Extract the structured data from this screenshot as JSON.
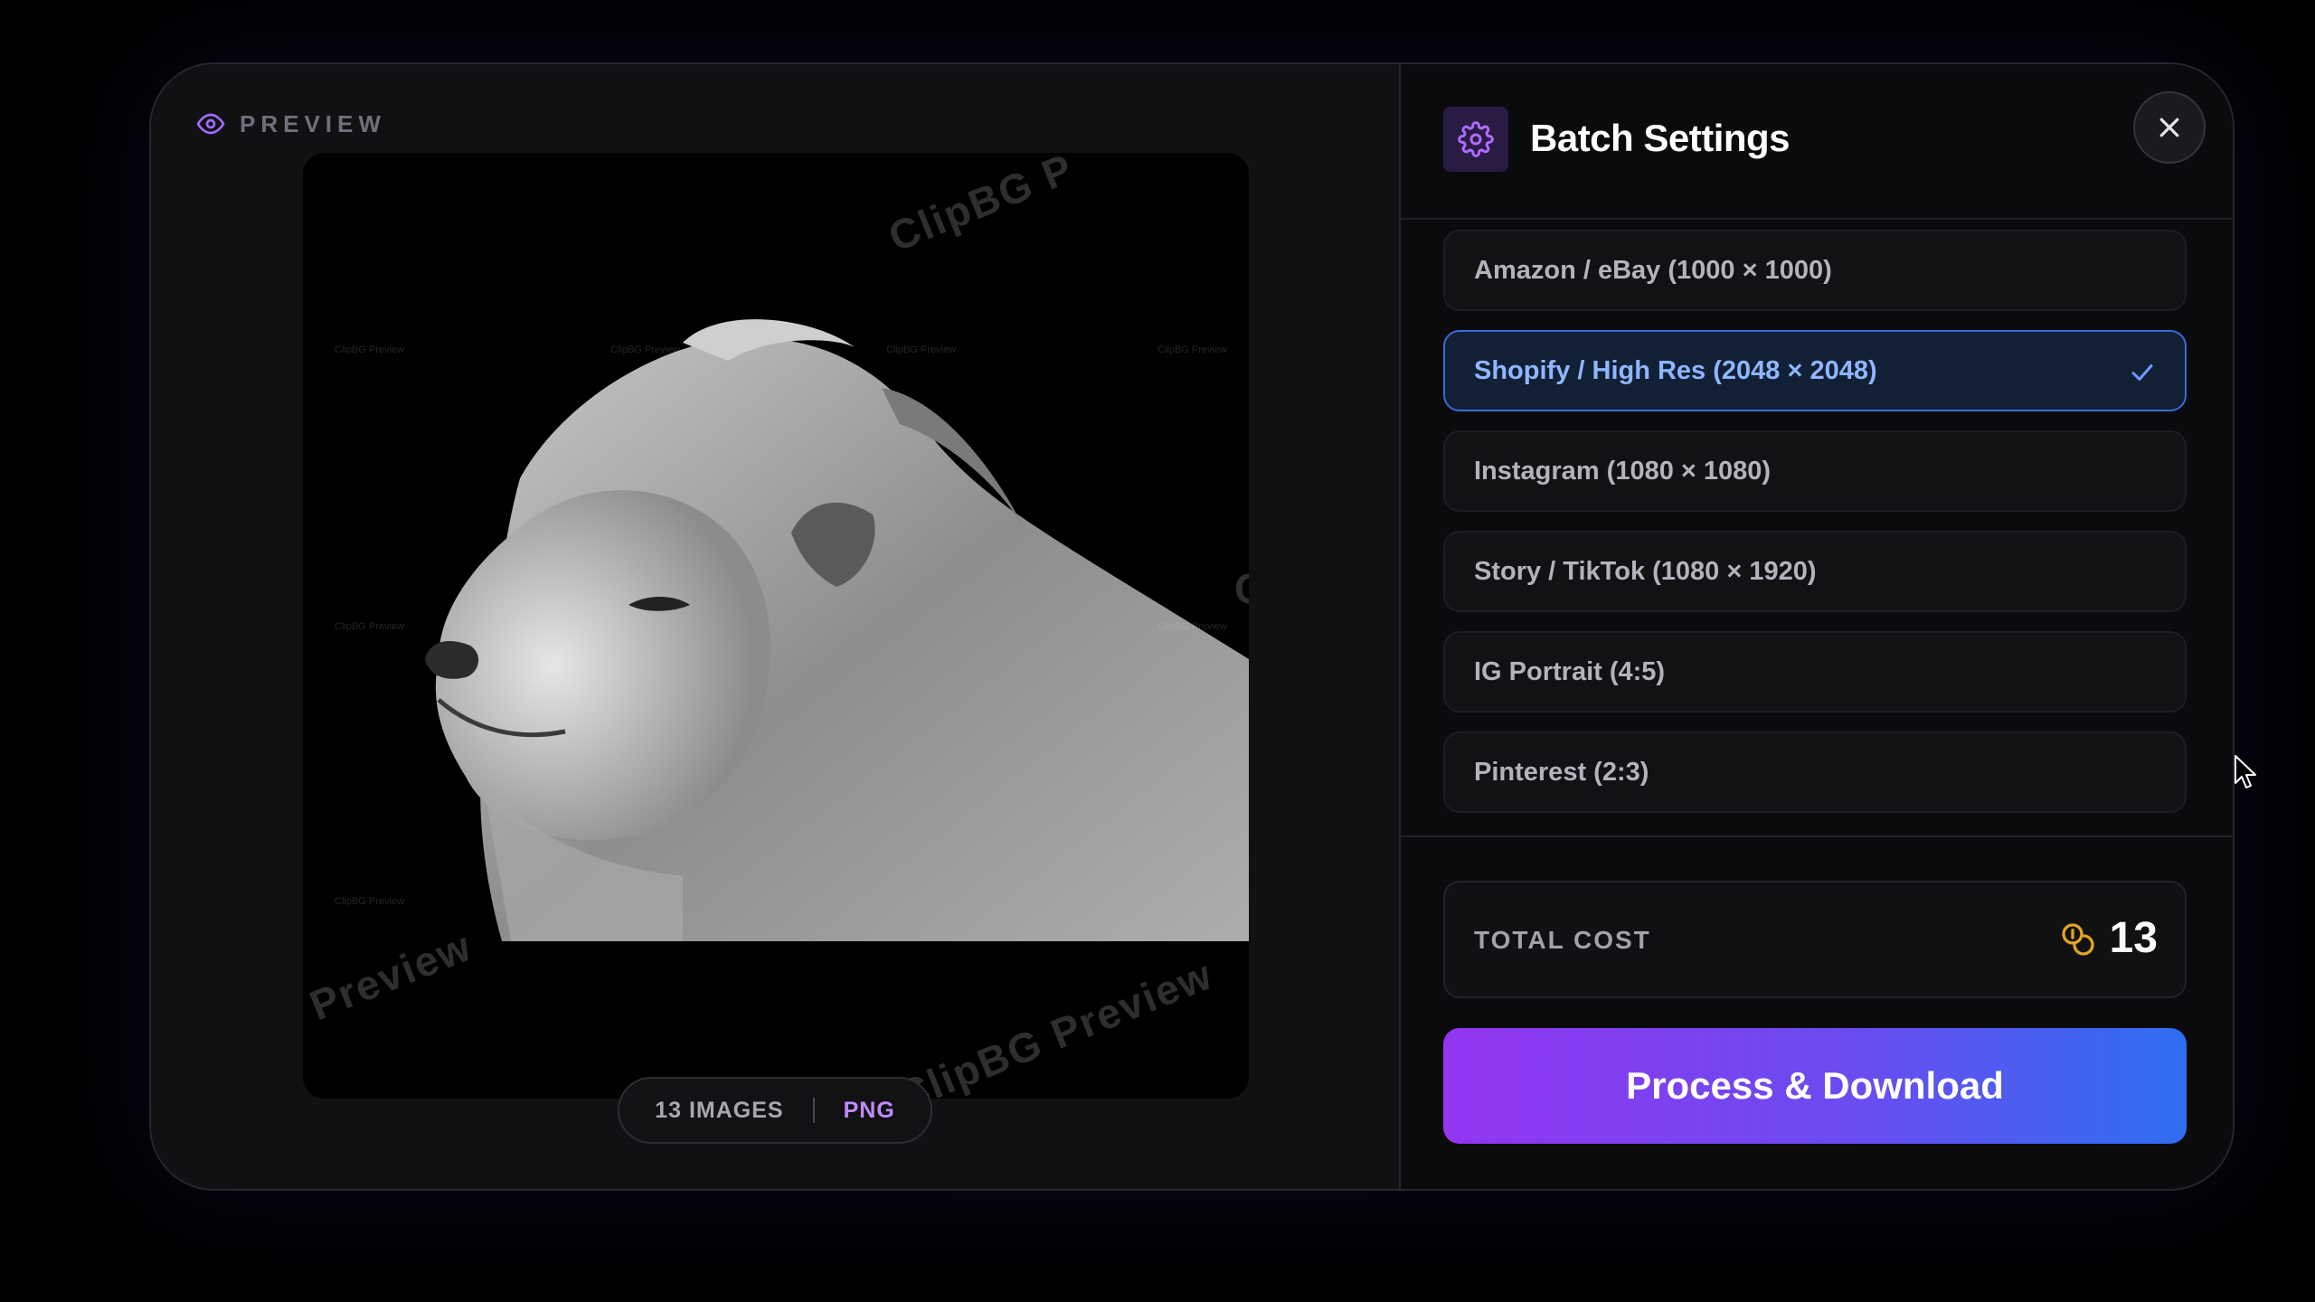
{
  "preview": {
    "label": "PREVIEW",
    "watermarks": [
      "ClipBG P",
      "Preview",
      "ClipBG Preview",
      "C"
    ],
    "tiny_watermark": "ClipBG Preview",
    "pill": {
      "count": "13 IMAGES",
      "format": "PNG"
    }
  },
  "settings": {
    "title": "Batch Settings",
    "options": [
      {
        "label": "Amazon / eBay (1000 × 1000)",
        "selected": false
      },
      {
        "label": "Shopify / High Res (2048 × 2048)",
        "selected": true
      },
      {
        "label": "Instagram (1080 × 1080)",
        "selected": false
      },
      {
        "label": "Story / TikTok (1080 × 1920)",
        "selected": false
      },
      {
        "label": "IG Portrait (4:5)",
        "selected": false
      },
      {
        "label": "Pinterest (2:3)",
        "selected": false
      }
    ],
    "cost": {
      "label": "TOTAL COST",
      "value": "13"
    },
    "cta_label": "Process & Download"
  },
  "colors": {
    "accent_purple": "#9335f0",
    "accent_blue": "#2e6ef0",
    "selected_border": "#3b6ad8",
    "coin": "#e0a520"
  },
  "icons": [
    "eye-icon",
    "gear-icon",
    "close-icon",
    "check-icon",
    "coins-icon",
    "cursor-icon"
  ]
}
